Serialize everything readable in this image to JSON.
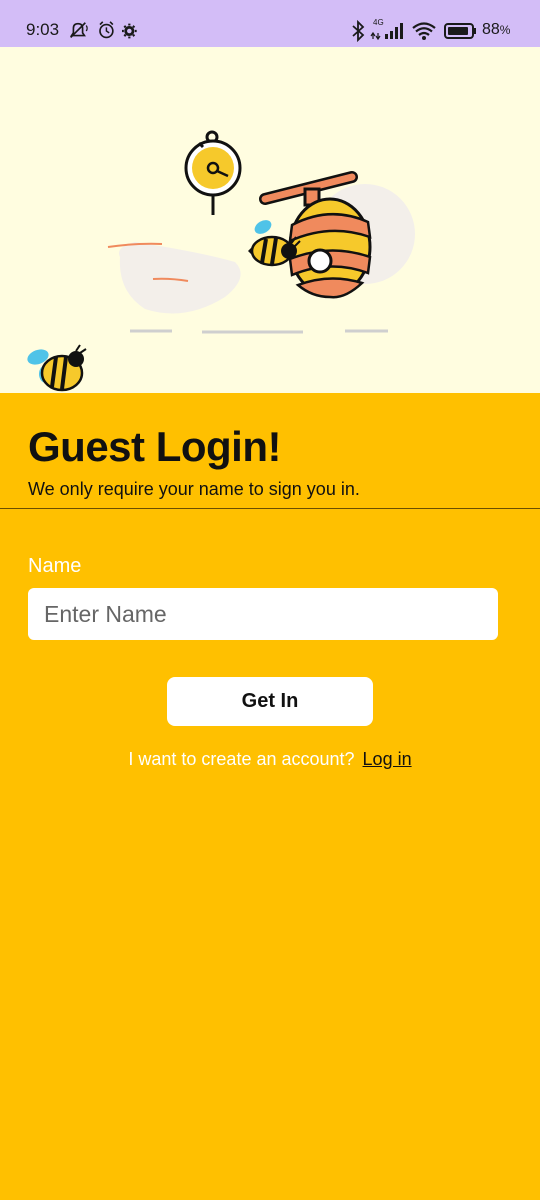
{
  "status_bar": {
    "time": "9:03",
    "network": "4G",
    "battery": "88",
    "battery_unit": "%",
    "icons": [
      "mute-icon",
      "alarm-icon",
      "settings-icon",
      "bluetooth-icon",
      "signal-icon",
      "wifi-icon",
      "battery-icon"
    ]
  },
  "illustration": {
    "icons": [
      "stopwatch-icon",
      "bee-icon",
      "honey-pot-icon",
      "bee-small-icon"
    ]
  },
  "login": {
    "title": "Guest Login!",
    "subtitle": "We only require your name to sign you in.",
    "name_label": "Name",
    "name_placeholder": "Enter Name",
    "name_value": "",
    "submit_label": "Get In",
    "footer_text": "I want to create an account?",
    "footer_link": "Log in"
  },
  "colors": {
    "status_bar_bg": "#D3BDF7",
    "illustration_bg": "#FFFDE0",
    "main_bg": "#FFC000",
    "button_bg": "#FFFFFF"
  }
}
